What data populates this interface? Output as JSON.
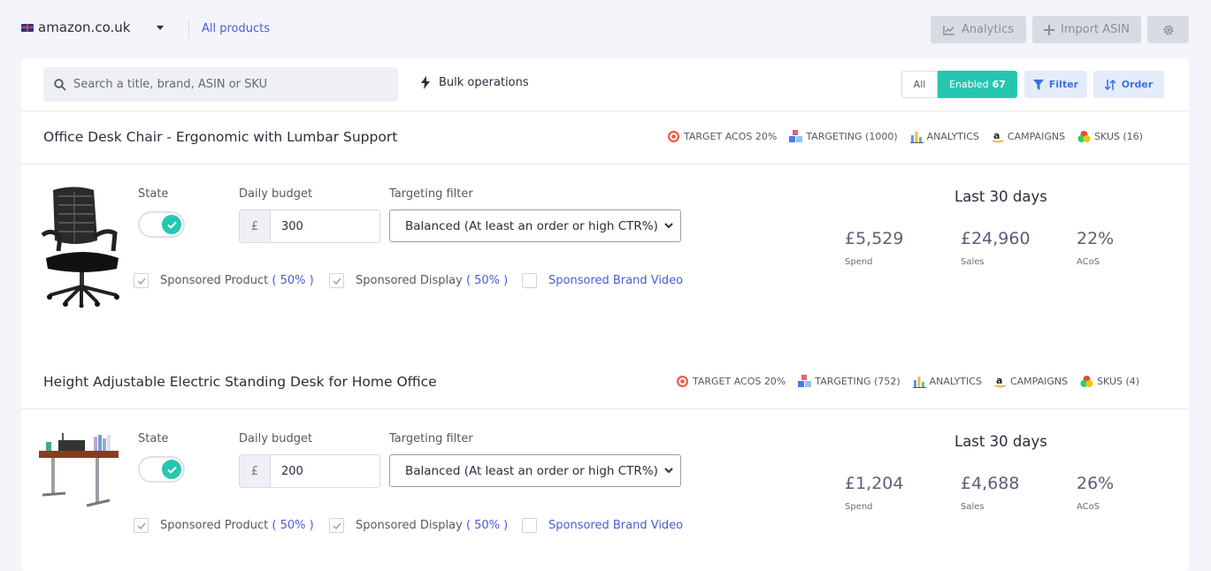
{
  "header": {
    "marketplace": "amazon.co.uk",
    "all_products": "All products",
    "analytics_label": "Analytics",
    "import_label": "Import ASIN"
  },
  "toolbar": {
    "search_placeholder": "Search a title, brand, ASIN or SKU",
    "bulk_label": "Bulk operations",
    "filter_all": "All",
    "filter_enabled": "Enabled",
    "enabled_count": "67",
    "filter_label": "Filter",
    "order_label": "Order"
  },
  "labels": {
    "state": "State",
    "daily_budget": "Daily budget",
    "targeting_filter": "Targeting filter",
    "last_30_days": "Last 30 days",
    "spend": "Spend",
    "sales": "Sales",
    "acos": "ACoS",
    "sponsored_product": "Sponsored Product",
    "sponsored_display": "Sponsored Display",
    "sponsored_brand_video": "Sponsored Brand Video",
    "target_acos": "TARGET ACOS 20%",
    "analytics_tag": "ANALYTICS",
    "campaigns_tag": "CAMPAIGNS",
    "currency": "£"
  },
  "products": [
    {
      "title": "Office Desk Chair - Ergonomic with Lumbar Support",
      "targeting": "TARGETING (1000)",
      "skus": "SKUS (16)",
      "enabled": true,
      "budget": "300",
      "targeting_filter": "Balanced (At least an order or high CTR%)",
      "sp_pct": "( 50% )",
      "sd_pct": "( 50% )",
      "sp_checked": true,
      "sd_checked": true,
      "sbv_checked": false,
      "spend": "£5,529",
      "sales": "£24,960",
      "acos": "22%"
    },
    {
      "title": "Height Adjustable Electric Standing Desk for Home Office",
      "targeting": "TARGETING (752)",
      "skus": "SKUS (4)",
      "enabled": true,
      "budget": "200",
      "targeting_filter": "Balanced (At least an order or high CTR%)",
      "sp_pct": "( 50% )",
      "sd_pct": "( 50% )",
      "sp_checked": true,
      "sd_checked": true,
      "sbv_checked": false,
      "spend": "£1,204",
      "sales": "£4,688",
      "acos": "26%"
    }
  ],
  "colors": {
    "accent": "#26c6b1",
    "link": "#4a5bd4",
    "filter_blue": "#3d6fe0"
  }
}
